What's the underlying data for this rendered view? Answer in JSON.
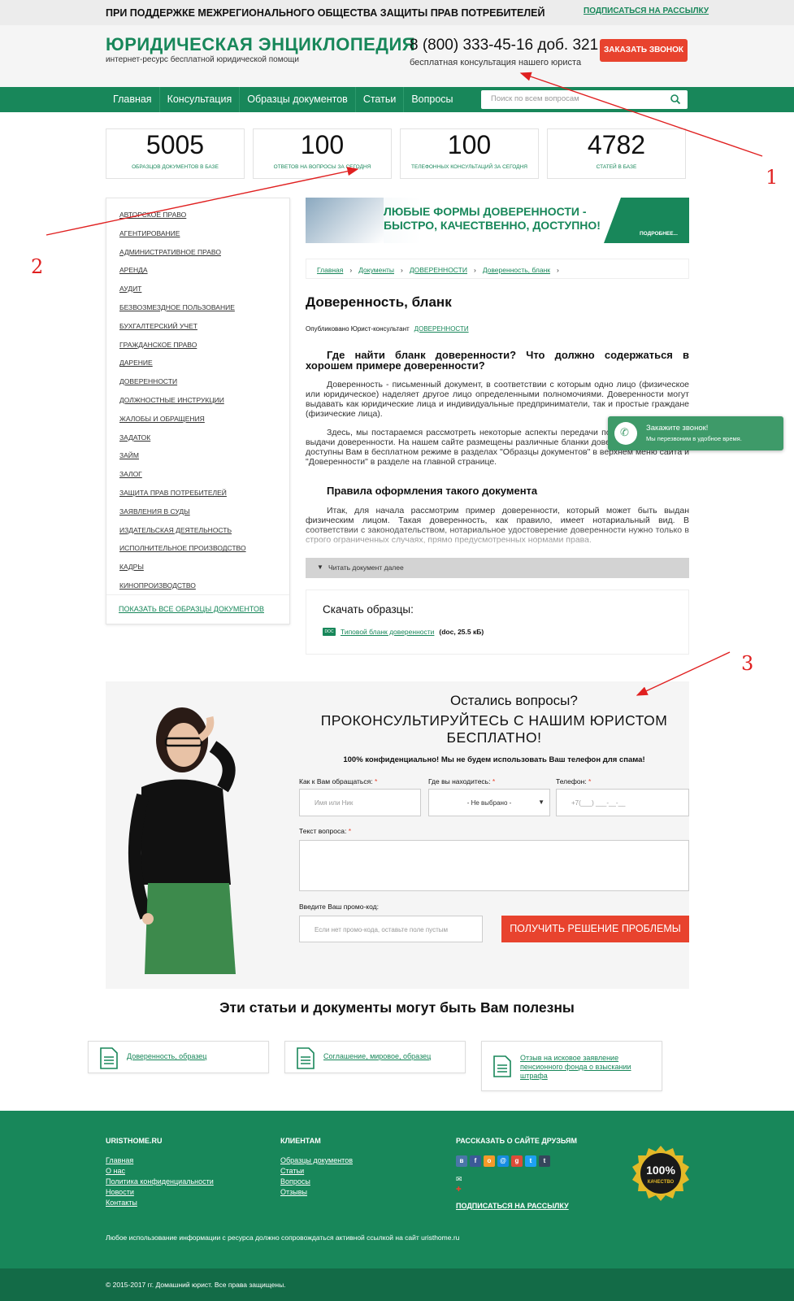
{
  "topbar": {
    "slogan": "ПРИ ПОДДЕРЖКЕ МЕЖРЕГИОНАЛЬНОГО ОБЩЕСТВА ЗАЩИТЫ ПРАВ ПОТРЕБИТЕЛЕЙ",
    "subscribe": "ПОДПИСАТЬСЯ НА РАССЫЛКУ"
  },
  "header": {
    "logo_title": "ЮРИДИЧЕСКАЯ ЭНЦИКЛОПЕДИЯ",
    "logo_sub": "интернет-ресурс бесплатной юридической помощи",
    "phone": "8 (800) 333-45-16 доб. 321",
    "phone_sub": "бесплатная консультация нашего юриста",
    "callback": "ЗАКАЗАТЬ ЗВОНОК"
  },
  "nav": {
    "items": [
      "Главная",
      "Консультация",
      "Образцы документов",
      "Статьи",
      "Вопросы"
    ],
    "search_placeholder": "Поиск по всем вопросам"
  },
  "stats": [
    {
      "num": "5005",
      "label": "ОБРАЗЦОВ ДОКУМЕНТОВ В БАЗЕ"
    },
    {
      "num": "100",
      "label": "ОТВЕТОВ НА ВОПРОСЫ ЗА СЕГОДНЯ"
    },
    {
      "num": "100",
      "label": "ТЕЛЕФОННЫХ КОНСУЛЬТАЦИЙ ЗА СЕГОДНЯ"
    },
    {
      "num": "4782",
      "label": "СТАТЕЙ В БАЗЕ"
    }
  ],
  "sidebar": {
    "items": [
      "АВТОРСКОЕ ПРАВО",
      "АГЕНТИРОВАНИЕ",
      "АДМИНИСТРАТИВНОЕ ПРАВО",
      "АРЕНДА",
      "АУДИТ",
      "БЕЗВОЗМЕЗДНОЕ ПОЛЬЗОВАНИЕ",
      "БУХГАЛТЕРСКИЙ УЧЕТ",
      "ГРАЖДАНСКОЕ ПРАВО",
      "ДАРЕНИЕ",
      "ДОВЕРЕННОСТИ",
      "ДОЛЖНОСТНЫЕ ИНСТРУКЦИИ",
      "ЖАЛОБЫ И ОБРАЩЕНИЯ",
      "ЗАДАТОК",
      "ЗАЙМ",
      "ЗАЛОГ",
      "ЗАЩИТА ПРАВ ПОТРЕБИТЕЛЕЙ",
      "ЗАЯВЛЕНИЯ В СУДЫ",
      "ИЗДАТЕЛЬСКАЯ ДЕЯТЕЛЬНОСТЬ",
      "ИСПОЛНИТЕЛЬНОЕ ПРОИЗВОДСТВО",
      "КАДРЫ",
      "КИНОПРОИЗВОДСТВО"
    ],
    "show_all": "ПОКАЗАТЬ ВСЕ ОБРАЗЦЫ ДОКУМЕНТОВ"
  },
  "banner": {
    "line1": "ЛЮБЫЕ ФОРМЫ ДОВЕРЕННОСТИ -",
    "line2": "БЫСТРО, КАЧЕСТВЕННО, ДОСТУПНО!",
    "more": "ПОДРОБНЕЕ..."
  },
  "breadcrumb": [
    "Главная",
    "Документы",
    "ДОВЕРЕННОСТИ",
    "Доверенность, бланк"
  ],
  "article": {
    "title": "Доверенность, бланк",
    "published": "Опубликовано Юрист-консультант",
    "category": "ДОВЕРЕННОСТИ",
    "h2": "Где найти бланк доверенности? Что должно содержаться в хорошем примере доверенности?",
    "p1": "Доверенность - письменный документ, в соответствии с которым одно лицо (физическое или юридическое) наделяет другое лицо определенными полномочиями. Доверенности могут выдавать как юридические лица и индивидуальные предприниматели, так и простые граждане (физические лица).",
    "p2": "Здесь, мы постараемся рассмотреть некоторые аспекты передачи полномочий в рамках выдачи доверенности. На нашем сайте размещены различные бланки доверенностей, которые доступны Вам в бесплатном режиме в разделах \"Образцы документов\" в верхнем меню сайта и \"Доверенности\" в разделе на главной странице.",
    "h3": "Правила оформления такого документа",
    "p3": "Итак, для начала рассмотрим пример доверенности, который может быть выдан физическим лицом. Такая доверенность, как правило, имеет нотариальный вид. В соответствии с законодательством, нотариальное удостоверение доверенности нужно только в строго ограниченных случаях, прямо предусмотренных нормами права.",
    "read_more": "Читать документ далее"
  },
  "downloads": {
    "title": "Скачать образцы:",
    "file_icon": "DOC",
    "file_link": "Типовой бланк доверенности",
    "file_meta": "(doc, 25.5 кБ)"
  },
  "call_widget": {
    "title": "Закажите звонок!",
    "sub": "Мы перезвоним в удобное время."
  },
  "form": {
    "q1": "Остались вопросы?",
    "q2": "ПРОКОНСУЛЬТИРУЙТЕСЬ С НАШИМ ЮРИСТОМ БЕСПЛАТНО!",
    "q3": "100% конфиденциально! Мы не будем использовать Ваш телефон для спама!",
    "name_label": "Как к Вам обращаться:",
    "name_placeholder": "Имя или Ник",
    "place_label": "Где вы находитесь:",
    "place_value": "- Не выбрано -",
    "phone_label": "Телефон:",
    "phone_placeholder": "+7(___) ___-__-__",
    "text_label": "Текст вопроса:",
    "promo_label": "Введите Ваш промо-код:",
    "promo_placeholder": "Если нет промо-кода, оставьте поле пустым",
    "submit": "ПОЛУЧИТЬ РЕШЕНИЕ ПРОБЛЕМЫ",
    "req": "*"
  },
  "useful": {
    "title": "Эти статьи и документы могут быть Вам полезны",
    "cards": [
      "Доверенность, образец",
      "Соглашение, мировое, образец",
      "Отзыв на исковое заявление пенсионного фонда о взыскании штрафа"
    ]
  },
  "footer": {
    "col1_title": "URISTHOME.RU",
    "col1_links": [
      "Главная",
      "О нас",
      "Политика конфиденциальности",
      "Новости",
      "Контакты"
    ],
    "col2_title": "КЛИЕНТАМ",
    "col2_links": [
      "Образцы документов",
      "Статьи",
      "Вопросы",
      "Отзывы"
    ],
    "col3_title": "РАССКАЗАТЬ О САЙТЕ ДРУЗЬЯМ",
    "col3_subscribe": "ПОДПИСАТЬСЯ НА РАССЫЛКУ",
    "badge_top": "100%",
    "badge_bottom": "КАЧЕСТВО",
    "note": "Любое использование информации с ресурса должно сопровождаться активной ссылкой на сайт uristhome.ru",
    "copyright": "© 2015-2017 гг. Домашний юрист. Все права защищены."
  },
  "annotations": {
    "n1": "1",
    "n2": "2",
    "n3": "3"
  },
  "colors": {
    "brand": "#18875a",
    "accent": "#e8432e",
    "annotation": "#e02020"
  }
}
